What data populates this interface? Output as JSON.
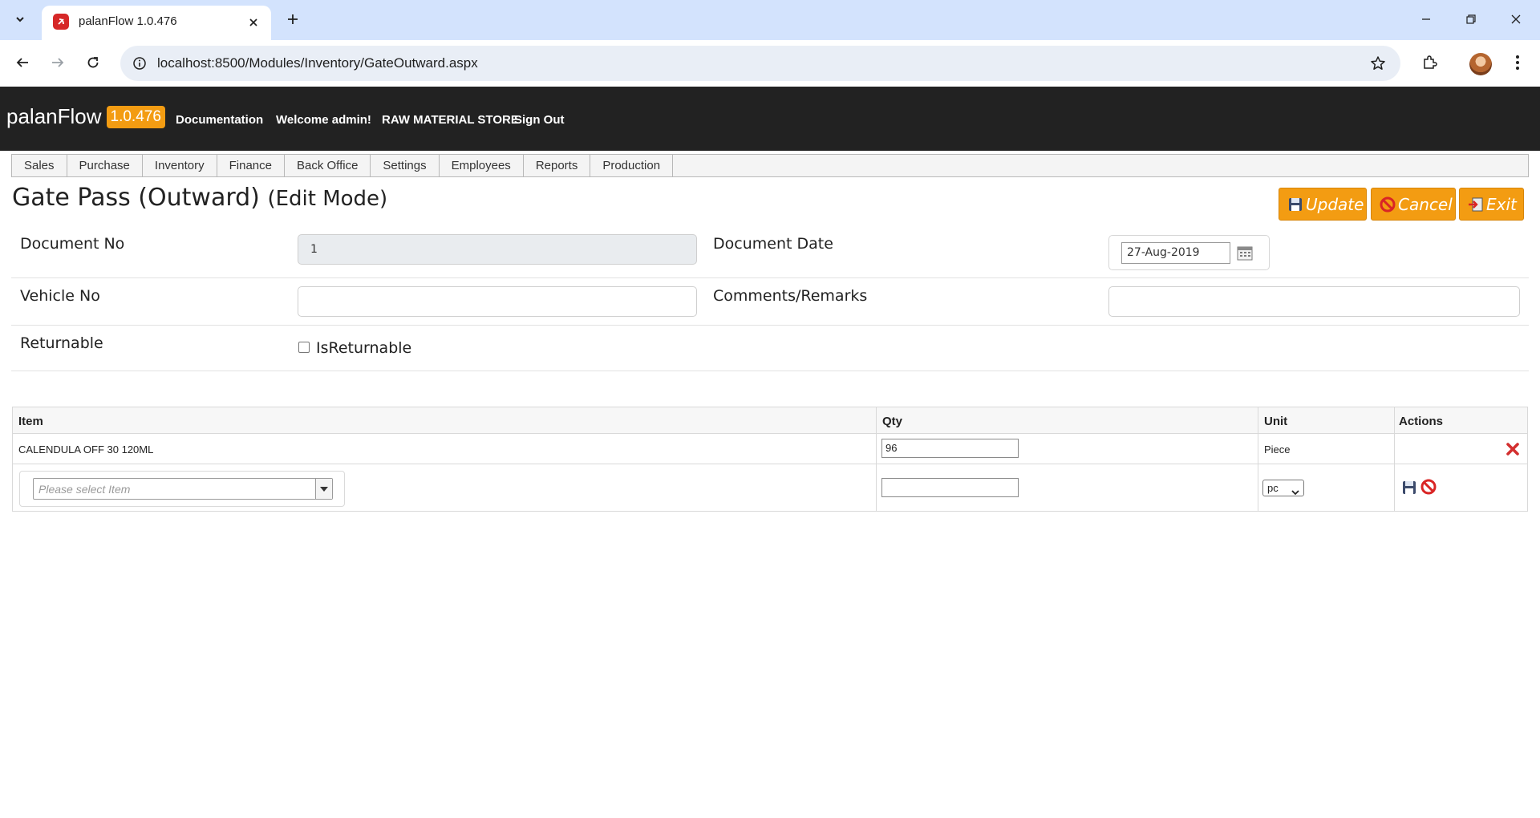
{
  "browser": {
    "tab_title": "palanFlow 1.0.476",
    "url": "localhost:8500/Modules/Inventory/GateOutward.aspx"
  },
  "app": {
    "brand": "palanFlow",
    "version": "1.0.476",
    "nav": [
      "Documentation",
      "Welcome admin!",
      "RAW MATERIAL STORE",
      "Sign Out"
    ],
    "menu": [
      "Sales",
      "Purchase",
      "Inventory",
      "Finance",
      "Back Office",
      "Settings",
      "Employees",
      "Reports",
      "Production"
    ]
  },
  "page": {
    "title": "Gate Pass (Outward)",
    "mode": "(Edit Mode)",
    "buttons": {
      "update": "Update",
      "cancel": "Cancel",
      "exit": "Exit"
    }
  },
  "form": {
    "document_no_label": "Document No",
    "document_no_value": "1",
    "document_date_label": "Document Date",
    "document_date_value": "27-Aug-2019",
    "vehicle_no_label": "Vehicle No",
    "vehicle_no_value": "",
    "comments_label": "Comments/Remarks",
    "comments_value": "",
    "returnable_label": "Returnable",
    "is_returnable_label": "IsReturnable",
    "is_returnable_checked": false
  },
  "grid": {
    "headers": [
      "Item",
      "Qty",
      "Unit",
      "Actions"
    ],
    "rows": [
      {
        "item": "CALENDULA OFF 30 120ML",
        "qty": "96",
        "unit": "Piece"
      }
    ],
    "new_row": {
      "item_placeholder": "Please select Item",
      "qty": "",
      "unit_selected": "pc"
    }
  },
  "colors": {
    "appbar": "#222222",
    "accent": "#f39c12",
    "delete": "#d32f2f"
  }
}
